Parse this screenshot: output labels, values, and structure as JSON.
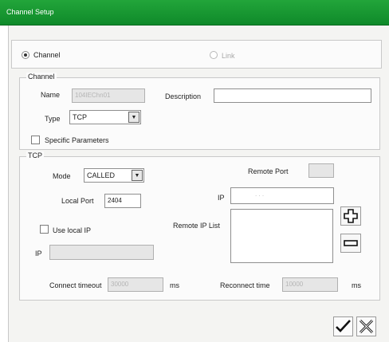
{
  "window": {
    "title": "Channel Setup"
  },
  "mode_select": {
    "channel_label": "Channel",
    "link_label": "Link"
  },
  "channel_group": {
    "legend": "Channel",
    "name_label": "Name",
    "name_value": "104IEChn01",
    "description_label": "Description",
    "description_value": "",
    "type_label": "Type",
    "type_value": "TCP",
    "specific_label": "Specific Parameters"
  },
  "tcp_group": {
    "legend": "TCP",
    "mode_label": "Mode",
    "mode_value": "CALLED",
    "remote_port_label": "Remote Port",
    "remote_port_value": "",
    "local_port_label": "Local Port",
    "local_port_value": "2404",
    "ip_label": "IP",
    "ip_dots": ".        .        .",
    "use_local_ip_label": "Use local IP",
    "remote_ip_list_label": "Remote IP List",
    "local_ip_label": "IP",
    "local_ip_value": "",
    "connect_timeout_label": "Connect timeout",
    "connect_timeout_value": "30000",
    "connect_unit": "ms",
    "reconnect_time_label": "Reconnect time",
    "reconnect_time_value": "10000",
    "reconnect_unit": "ms"
  },
  "icons": {
    "add": "plus-icon",
    "remove": "minus-icon",
    "ok": "checkmark-icon",
    "cancel": "cross-icon"
  },
  "colors": {
    "titlebar": "#1a9c34"
  }
}
